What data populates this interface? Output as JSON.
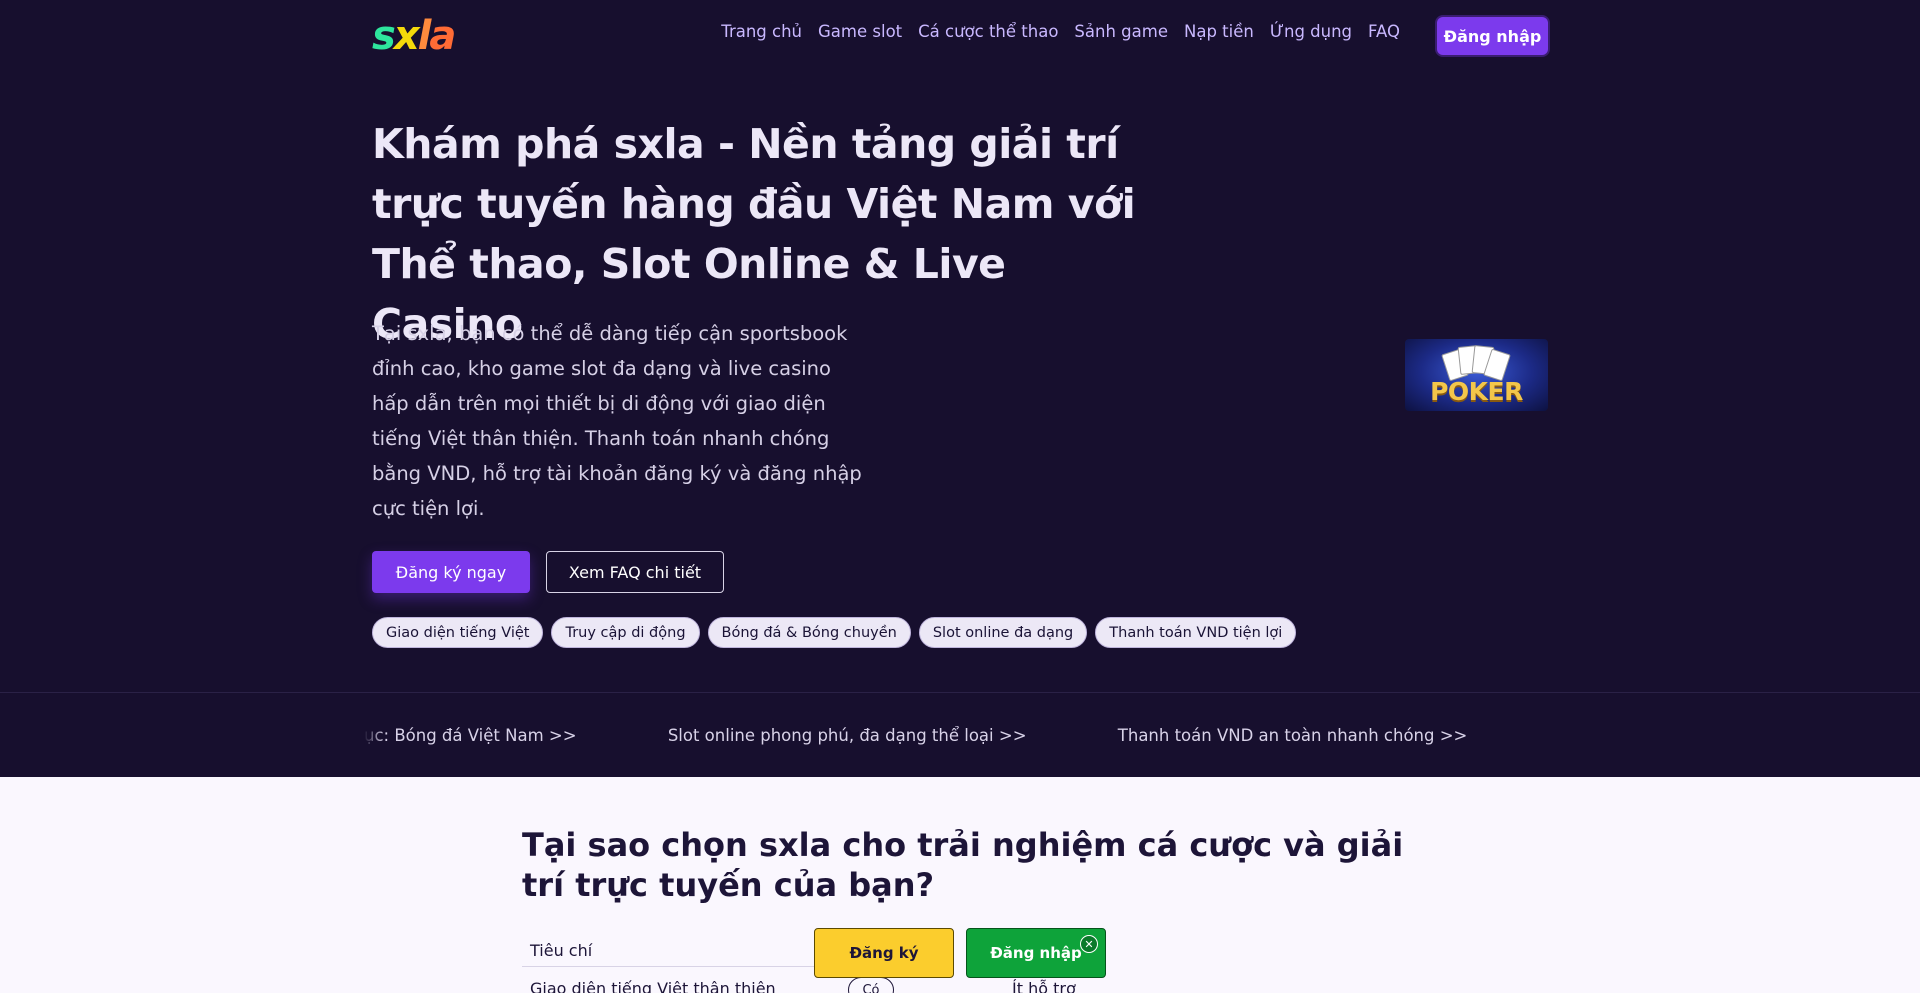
{
  "brand": {
    "logo_text": "sxla",
    "colors": {
      "s": "#2ee59d",
      "x": "#f5d90a",
      "l": "#ff8a3d",
      "a": "#ff6b35"
    }
  },
  "header": {
    "nav": [
      "Trang chủ",
      "Game slot",
      "Cá cược thể thao",
      "Sảnh game",
      "Nạp tiền",
      "Ứng dụng",
      "FAQ"
    ],
    "login_label": "Đăng nhập"
  },
  "hero": {
    "title_lines": [
      "Khám phá sxla - Nền tảng giải trí",
      "trực tuyến hàng đầu Việt Nam với",
      "Thể thao, Slot Online & Live Casino"
    ],
    "description": "Tại sxla, bạn có thể dễ dàng tiếp cận sportsbook đỉnh cao, kho game slot đa dạng và live casino hấp dẫn trên mọi thiết bị di động với giao diện tiếng Việt thân thiện. Thanh toán nhanh chóng bằng VND, hỗ trợ tài khoản đăng ký và đăng nhập cực tiện lợi.",
    "primary_button": "Đăng ký ngay",
    "secondary_button": "Xem FAQ chi tiết",
    "tags": [
      "Giao diện tiếng Việt",
      "Truy cập di động",
      "Bóng đá & Bóng chuyền",
      "Slot online đa dạng",
      "Thanh toán VND tiện lợi"
    ],
    "image_label": "POKER"
  },
  "ticker": {
    "items": [
      "ục: Bóng đá Việt Nam >>",
      "Slot online phong phú, đa dạng thể loại >>",
      "Thanh toán VND an toàn nhanh chóng >>"
    ]
  },
  "section": {
    "title": "Tại sao chọn sxla cho trải nghiệm cá cược và giải trí trực tuyến của bạn?",
    "table_header": "Tiêu chí",
    "row_label": "Giao diện tiếng Việt thân thiện",
    "row_badge": "Có",
    "row_other": "Ít hỗ trợ"
  },
  "floating_cta": {
    "register_label": "Đăng ký",
    "login_label": "Đăng nhập",
    "close_symbol": "✕"
  },
  "accent_colors": {
    "primary": "#7c3aed",
    "register": "#fbcd2d",
    "login": "#0ea33a",
    "background": "#170f2e"
  }
}
